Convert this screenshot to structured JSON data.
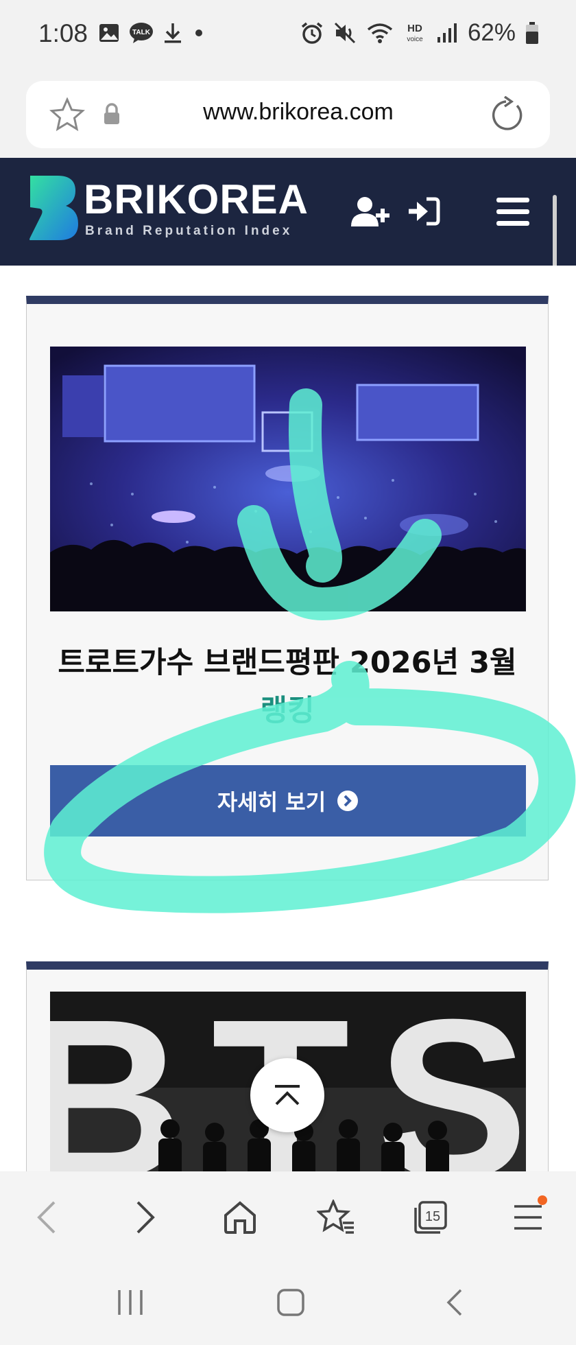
{
  "status_bar": {
    "time": "1:08",
    "battery_percent": "62%",
    "left_icons": [
      "gallery-icon",
      "kakaotalk-icon",
      "download-icon",
      "dot-icon"
    ],
    "right_icons": [
      "alarm-icon",
      "mute-icon",
      "wifi-icon",
      "hd-voice-icon",
      "signal-icon",
      "battery-icon"
    ],
    "hd_label": "HD",
    "voice_label": "voice",
    "talk_label": "TALK"
  },
  "browser": {
    "url": "www.brikorea.com",
    "tab_count": "15"
  },
  "site": {
    "logo_title": "BRIKOREA",
    "logo_subtitle": "Brand Reputation Index",
    "brand_color": "#1c2540"
  },
  "cards": [
    {
      "title": "트로트가수 브랜드평판 2026년 3월",
      "title_highlight": "랭킹",
      "button_label": "자세히 보기",
      "image": "concert-arena-image"
    },
    {
      "title": "",
      "image": "bts-poster-image",
      "image_letters": "BTS"
    }
  ],
  "colors": {
    "button": "#3a5ea6",
    "card_top_border": "#2f3b63",
    "ranking_text": "#1b8f7e",
    "scribble": "#5ef0d2",
    "notification_dot": "#f26522"
  }
}
